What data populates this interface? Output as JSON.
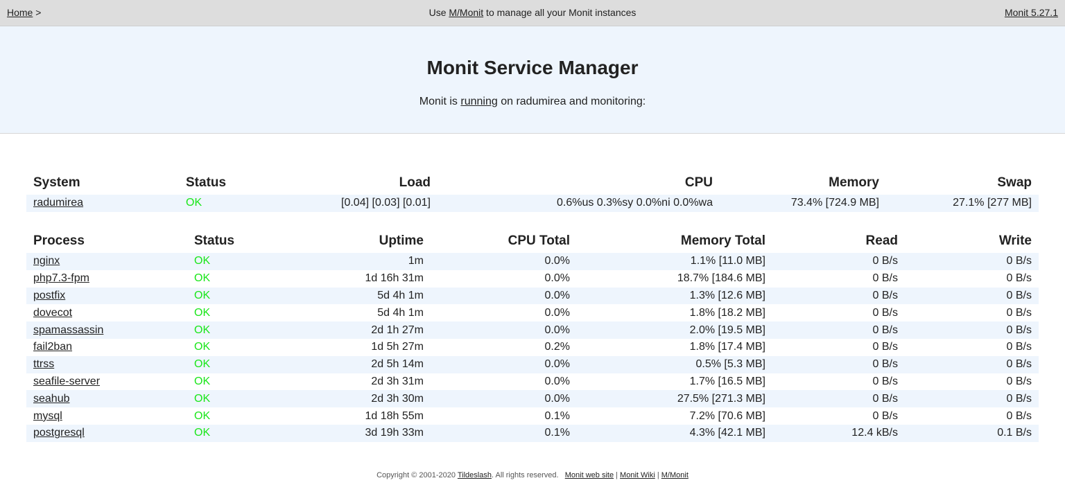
{
  "topbar": {
    "home_link": "Home",
    "home_sep": ">",
    "center_prefix": "Use ",
    "center_link": "M/Monit",
    "center_suffix": " to manage all your Monit instances",
    "version_link": "Monit 5.27.1"
  },
  "header": {
    "title": "Monit Service Manager",
    "sub_prefix": "Monit is ",
    "sub_link": "running",
    "sub_suffix": " on radumirea and monitoring:"
  },
  "system_table": {
    "headers": [
      "System",
      "Status",
      "Load",
      "CPU",
      "Memory",
      "Swap"
    ],
    "rows": [
      {
        "name": "radumirea",
        "status": "OK",
        "load": "[0.04] [0.03] [0.01]",
        "cpu": "0.6%us 0.3%sy 0.0%ni 0.0%wa",
        "memory": "73.4% [724.9 MB]",
        "swap": "27.1% [277 MB]"
      }
    ]
  },
  "process_table": {
    "headers": [
      "Process",
      "Status",
      "Uptime",
      "CPU Total",
      "Memory Total",
      "Read",
      "Write"
    ],
    "rows": [
      {
        "name": "nginx",
        "status": "OK",
        "uptime": "1m",
        "cpu": "0.0%",
        "memory": "1.1% [11.0 MB]",
        "read": "0 B/s",
        "write": "0 B/s"
      },
      {
        "name": "php7.3-fpm",
        "status": "OK",
        "uptime": "1d 16h 31m",
        "cpu": "0.0%",
        "memory": "18.7% [184.6 MB]",
        "read": "0 B/s",
        "write": "0 B/s"
      },
      {
        "name": "postfix",
        "status": "OK",
        "uptime": "5d 4h 1m",
        "cpu": "0.0%",
        "memory": "1.3% [12.6 MB]",
        "read": "0 B/s",
        "write": "0 B/s"
      },
      {
        "name": "dovecot",
        "status": "OK",
        "uptime": "5d 4h 1m",
        "cpu": "0.0%",
        "memory": "1.8% [18.2 MB]",
        "read": "0 B/s",
        "write": "0 B/s"
      },
      {
        "name": "spamassassin",
        "status": "OK",
        "uptime": "2d 1h 27m",
        "cpu": "0.0%",
        "memory": "2.0% [19.5 MB]",
        "read": "0 B/s",
        "write": "0 B/s"
      },
      {
        "name": "fail2ban",
        "status": "OK",
        "uptime": "1d 5h 27m",
        "cpu": "0.2%",
        "memory": "1.8% [17.4 MB]",
        "read": "0 B/s",
        "write": "0 B/s"
      },
      {
        "name": "ttrss",
        "status": "OK",
        "uptime": "2d 5h 14m",
        "cpu": "0.0%",
        "memory": "0.5% [5.3 MB]",
        "read": "0 B/s",
        "write": "0 B/s"
      },
      {
        "name": "seafile-server",
        "status": "OK",
        "uptime": "2d 3h 31m",
        "cpu": "0.0%",
        "memory": "1.7% [16.5 MB]",
        "read": "0 B/s",
        "write": "0 B/s"
      },
      {
        "name": "seahub",
        "status": "OK",
        "uptime": "2d 3h 30m",
        "cpu": "0.0%",
        "memory": "27.5% [271.3 MB]",
        "read": "0 B/s",
        "write": "0 B/s"
      },
      {
        "name": "mysql",
        "status": "OK",
        "uptime": "1d 18h 55m",
        "cpu": "0.1%",
        "memory": "7.2% [70.6 MB]",
        "read": "0 B/s",
        "write": "0 B/s"
      },
      {
        "name": "postgresql",
        "status": "OK",
        "uptime": "3d 19h 33m",
        "cpu": "0.1%",
        "memory": "4.3% [42.1 MB]",
        "read": "12.4 kB/s",
        "write": "0.1 B/s"
      }
    ]
  },
  "footer": {
    "copyright": "Copyright © 2001-2020 ",
    "company_link": "Tildeslash",
    "rights": ". All rights reserved.",
    "links": [
      "Monit web site",
      "Monit Wiki",
      "M/Monit"
    ],
    "separator": "|"
  },
  "colors": {
    "topbar_bg": "#dddddd",
    "header_bg": "#eef5fd",
    "row_stripe": "#eef5fd",
    "status_ok": "#19e619"
  }
}
